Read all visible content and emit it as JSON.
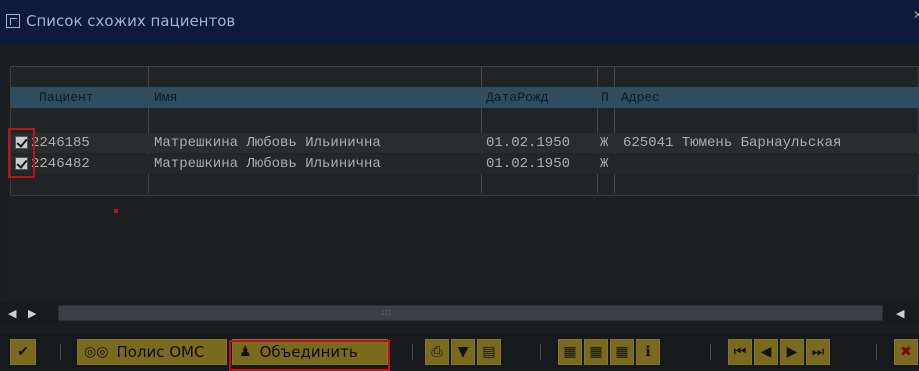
{
  "window": {
    "title": "Список схожих пациентов"
  },
  "table": {
    "columns": [
      "Пациент",
      "Имя",
      "ДатаРожд",
      "П",
      "Адрес"
    ],
    "rows": [
      {
        "checked": true,
        "patient": "2246185",
        "name": "Матрешкина Любовь Ильинична",
        "birth": "01.02.1950",
        "sex": "Ж",
        "address": "625041 Тюмень Барнаульская"
      },
      {
        "checked": true,
        "patient": "2246482",
        "name": "Матрешкина Любовь Ильинична",
        "birth": "01.02.1950",
        "sex": "Ж",
        "address": ""
      }
    ]
  },
  "toolbar": {
    "oms_label": "Полис ОМС",
    "merge_label": "Объединить"
  },
  "colors": {
    "header_bg": "#2e4d60",
    "highlight_red": "#c0121b",
    "button_yellow": "#7a6a1e"
  },
  "icons": [
    "window-icon",
    "checkmark-icon",
    "glasses-icon",
    "people-icon",
    "print-icon",
    "filter-icon",
    "export-icon",
    "grid-icon",
    "grid-select-icon",
    "grid-cols-icon",
    "info-icon",
    "first-page-icon",
    "prev-page-icon",
    "next-page-icon",
    "last-page-icon",
    "cancel-icon"
  ]
}
